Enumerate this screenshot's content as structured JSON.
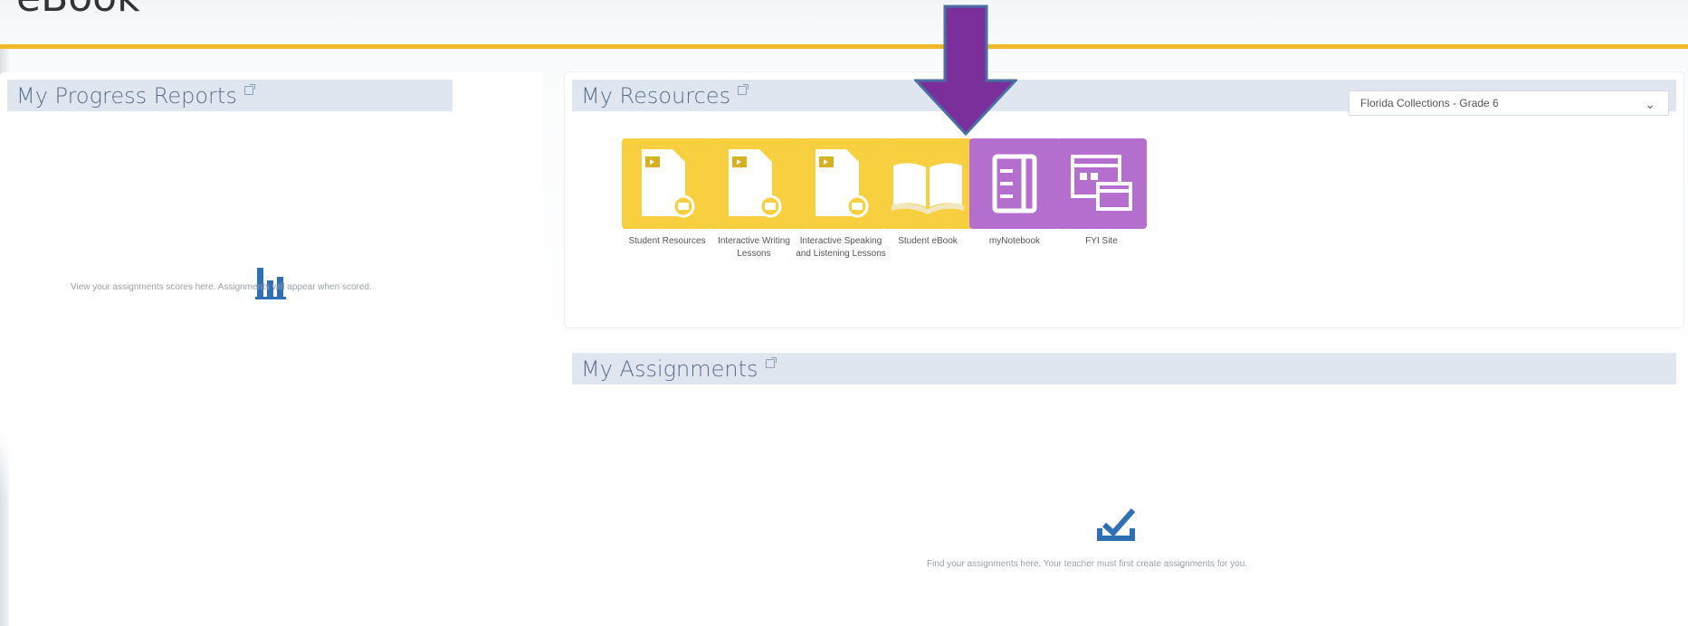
{
  "page": {
    "top_title": "eBook"
  },
  "progress": {
    "title": "My Progress Reports",
    "empty_message": "View your assignments scores here. Assignments will appear when scored."
  },
  "resources": {
    "title": "My Resources",
    "selected_collection": "Florida Collections - Grade 6",
    "tiles": [
      {
        "label": "Student Resources",
        "icon": "document-video-icon",
        "color": "#f8cf3e"
      },
      {
        "label": "Interactive Writing Lessons",
        "icon": "document-video-icon",
        "color": "#f8cf3e"
      },
      {
        "label": "Interactive Speaking and Listening Lessons",
        "icon": "document-video-icon",
        "color": "#f8cf3e"
      },
      {
        "label": "Student eBook",
        "icon": "open-book-icon",
        "color": "#f8cf3e"
      },
      {
        "label": "myNotebook",
        "icon": "notebook-icon",
        "color": "#b46fce"
      },
      {
        "label": "FYI Site",
        "icon": "browser-window-icon",
        "color": "#b46fce"
      }
    ]
  },
  "assignments": {
    "title": "My Assignments",
    "empty_message": "Find your assignments here. Your teacher must first create assignments for you."
  },
  "colors": {
    "accent_gold": "#f0b82a",
    "annotation_arrow": "#7b2f9b",
    "header_bg": "#dfe6f0"
  }
}
